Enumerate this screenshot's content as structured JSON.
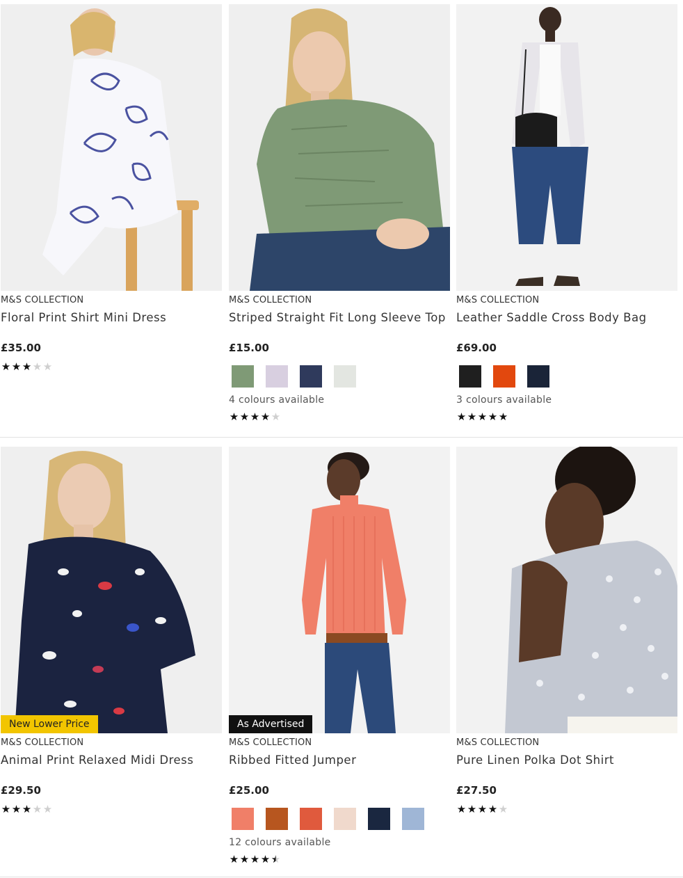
{
  "row1": [
    {
      "brand": "M&S COLLECTION",
      "title": "Floral Print Shirt Mini Dress",
      "price": "£35.00",
      "rating": 3,
      "badge": "",
      "image": "woman-floral-dress-photo",
      "swatches": [],
      "colours_text": ""
    },
    {
      "brand": "M&S COLLECTION",
      "title": "Striped Straight Fit Long Sleeve Top",
      "price": "£15.00",
      "rating": 4,
      "badge": "",
      "image": "woman-green-top-photo",
      "swatches": [
        "#7f9a76",
        "#d8cfe0",
        "#2f3a5c",
        "#e3e6e1"
      ],
      "colours_text": "4 colours available"
    },
    {
      "brand": "M&S COLLECTION",
      "title": "Leather Saddle Cross Body Bag",
      "price": "£69.00",
      "rating": 5,
      "badge": "",
      "image": "woman-saddle-bag-photo",
      "swatches": [
        "#1f1f1f",
        "#e2480e",
        "#1a2438"
      ],
      "colours_text": "3 colours available"
    }
  ],
  "row2": [
    {
      "brand": "M&S COLLECTION",
      "title": "Animal Print Relaxed Midi Dress",
      "price": "£29.50",
      "rating": 3,
      "badge": "New Lower Price",
      "image": "woman-animal-print-dress-photo",
      "swatches": [],
      "colours_text": ""
    },
    {
      "brand": "M&S COLLECTION",
      "title": "Ribbed Fitted Jumper",
      "price": "£25.00",
      "rating": 4.5,
      "badge": "As Advertised",
      "image": "woman-coral-jumper-photo",
      "swatches": [
        "#f07f68",
        "#b7561f",
        "#e05a3d",
        "#f0d9cc",
        "#1a2740",
        "#9fb6d6"
      ],
      "colours_text": "12 colours available"
    },
    {
      "brand": "M&S COLLECTION",
      "title": "Pure Linen Polka Dot Shirt",
      "price": "£27.50",
      "rating": 4,
      "badge": "",
      "image": "woman-linen-shirt-photo",
      "swatches": [],
      "colours_text": ""
    }
  ]
}
